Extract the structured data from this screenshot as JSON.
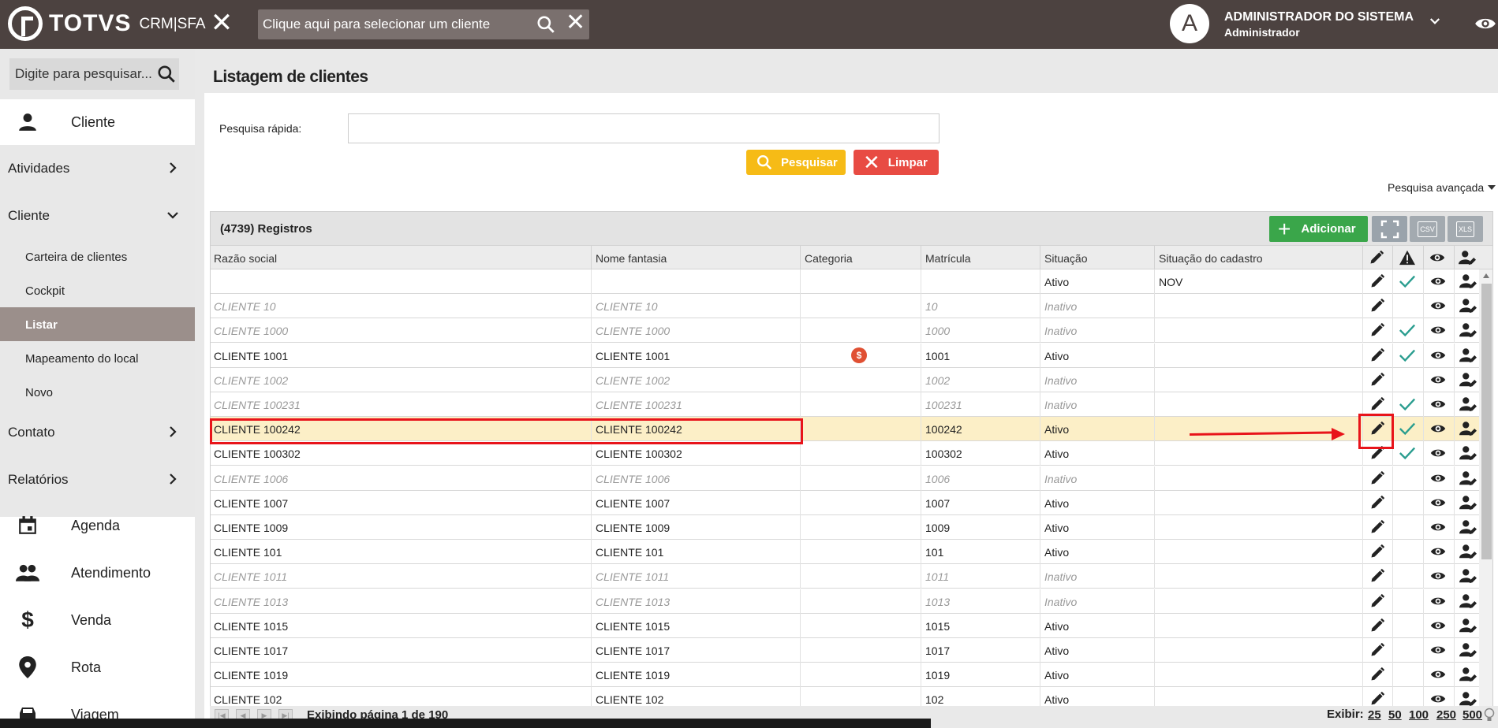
{
  "topbar": {
    "brand": "TOTVS",
    "brand_sub": "CRM|SFA",
    "client_search_placeholder": "Clique aqui para selecionar um cliente",
    "avatar_letter": "A",
    "user_name": "ADMINISTRADOR DO SISTEMA",
    "user_role": "Administrador"
  },
  "sidebar": {
    "search_placeholder": "Digite para pesquisar...",
    "top_item": "Cliente",
    "groups": {
      "atividades": "Atividades",
      "cliente": "Cliente",
      "contato": "Contato",
      "relatorios": "Relatórios"
    },
    "cliente_items": [
      "Carteira de clientes",
      "Cockpit",
      "Listar",
      "Mapeamento do local",
      "Novo"
    ],
    "selected_item": "Listar",
    "lower_items": [
      "Agenda",
      "Atendimento",
      "Venda",
      "Rota",
      "Viagem"
    ]
  },
  "page": {
    "title": "Listagem de clientes",
    "quick_search_label": "Pesquisa rápida:",
    "quick_search_value": "",
    "search_button": "Pesquisar",
    "clear_button": "Limpar",
    "advanced_search": "Pesquisa avançada"
  },
  "grid": {
    "record_count": "(4739) Registros",
    "add_button": "Adicionar",
    "csv_label": "CSV",
    "xls_label": "XLS",
    "columns": [
      "Razão social",
      "Nome fantasia",
      "Categoria",
      "Matrícula",
      "Situação",
      "Situação do cadastro"
    ],
    "rows": [
      {
        "razao": "",
        "fantasia": "",
        "categoria": "",
        "matricula": "",
        "situacao": "Ativo",
        "cadastro": "NOV",
        "inactive": false,
        "check": true
      },
      {
        "razao": "CLIENTE 10",
        "fantasia": "CLIENTE 10",
        "categoria": "",
        "matricula": "10",
        "situacao": "Inativo",
        "cadastro": "",
        "inactive": true,
        "check": false
      },
      {
        "razao": "CLIENTE 1000",
        "fantasia": "CLIENTE 1000",
        "categoria": "",
        "matricula": "1000",
        "situacao": "Inativo",
        "cadastro": "",
        "inactive": true,
        "check": true
      },
      {
        "razao": "CLIENTE 1001",
        "fantasia": "CLIENTE 1001",
        "categoria": "$",
        "matricula": "1001",
        "situacao": "Ativo",
        "cadastro": "",
        "inactive": false,
        "check": true
      },
      {
        "razao": "CLIENTE 1002",
        "fantasia": "CLIENTE 1002",
        "categoria": "",
        "matricula": "1002",
        "situacao": "Inativo",
        "cadastro": "",
        "inactive": true,
        "check": false
      },
      {
        "razao": "CLIENTE 100231",
        "fantasia": "CLIENTE 100231",
        "categoria": "",
        "matricula": "100231",
        "situacao": "Inativo",
        "cadastro": "",
        "inactive": true,
        "check": true
      },
      {
        "razao": "CLIENTE 100242",
        "fantasia": "CLIENTE 100242",
        "categoria": "",
        "matricula": "100242",
        "situacao": "Ativo",
        "cadastro": "",
        "inactive": false,
        "check": true,
        "selected": true
      },
      {
        "razao": "CLIENTE 100302",
        "fantasia": "CLIENTE 100302",
        "categoria": "",
        "matricula": "100302",
        "situacao": "Ativo",
        "cadastro": "",
        "inactive": false,
        "check": true
      },
      {
        "razao": "CLIENTE 1006",
        "fantasia": "CLIENTE 1006",
        "categoria": "",
        "matricula": "1006",
        "situacao": "Inativo",
        "cadastro": "",
        "inactive": true,
        "check": false
      },
      {
        "razao": "CLIENTE 1007",
        "fantasia": "CLIENTE 1007",
        "categoria": "",
        "matricula": "1007",
        "situacao": "Ativo",
        "cadastro": "",
        "inactive": false,
        "check": false
      },
      {
        "razao": "CLIENTE 1009",
        "fantasia": "CLIENTE 1009",
        "categoria": "",
        "matricula": "1009",
        "situacao": "Ativo",
        "cadastro": "",
        "inactive": false,
        "check": false
      },
      {
        "razao": "CLIENTE 101",
        "fantasia": "CLIENTE 101",
        "categoria": "",
        "matricula": "101",
        "situacao": "Ativo",
        "cadastro": "",
        "inactive": false,
        "check": false
      },
      {
        "razao": "CLIENTE 1011",
        "fantasia": "CLIENTE 1011",
        "categoria": "",
        "matricula": "1011",
        "situacao": "Inativo",
        "cadastro": "",
        "inactive": true,
        "check": false
      },
      {
        "razao": "CLIENTE 1013",
        "fantasia": "CLIENTE 1013",
        "categoria": "",
        "matricula": "1013",
        "situacao": "Inativo",
        "cadastro": "",
        "inactive": true,
        "check": false
      },
      {
        "razao": "CLIENTE 1015",
        "fantasia": "CLIENTE 1015",
        "categoria": "",
        "matricula": "1015",
        "situacao": "Ativo",
        "cadastro": "",
        "inactive": false,
        "check": false
      },
      {
        "razao": "CLIENTE 1017",
        "fantasia": "CLIENTE 1017",
        "categoria": "",
        "matricula": "1017",
        "situacao": "Ativo",
        "cadastro": "",
        "inactive": false,
        "check": false
      },
      {
        "razao": "CLIENTE 1019",
        "fantasia": "CLIENTE 1019",
        "categoria": "",
        "matricula": "1019",
        "situacao": "Ativo",
        "cadastro": "",
        "inactive": false,
        "check": false
      },
      {
        "razao": "CLIENTE 102",
        "fantasia": "CLIENTE 102",
        "categoria": "",
        "matricula": "102",
        "situacao": "Ativo",
        "cadastro": "",
        "inactive": false,
        "check": false
      }
    ]
  },
  "pager": {
    "page_text": "Exibindo página 1 de 190",
    "exibir_label": "Exibir:",
    "page_sizes": [
      "25",
      "50",
      "100",
      "250",
      "500"
    ]
  },
  "colors": {
    "topbar": "#4c4240",
    "selected_menu": "#9b8f8b",
    "selected_row": "#fcefc7",
    "add_button": "#3aa64a",
    "search_button": "#f6bb16",
    "clear_button": "#e84b43",
    "check": "#2a9d8f",
    "annotation": "#e8141a"
  }
}
